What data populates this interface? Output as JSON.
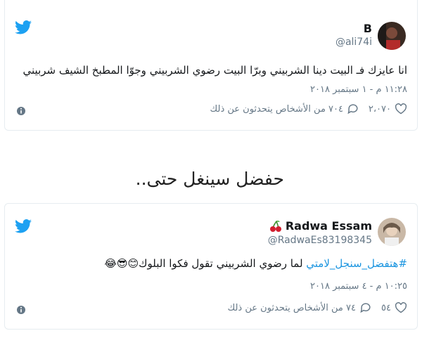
{
  "tweet1": {
    "display_name": "B",
    "handle": "@ali74i",
    "text": "انا عايزك فـ البيت دينا الشربيني وبرّا البيت رضوي الشربيني وجوّا المطبخ الشيف شربيني",
    "timestamp": "١١:٢٨ م - ١ سبتمبر ٢٠١٨",
    "likes": "٢،٠٧٠",
    "replies_text": "٧٠٤ من الأشخاص يتحدثون عن ذلك"
  },
  "heading": "حفضل سينغل حتى..",
  "tweet2": {
    "display_name": "Radwa Essam",
    "handle": "@RadwaEs83198345",
    "hashtag": "#هتفضل_سنجل_لامتي",
    "text_rest": " لما رضوي الشربيني تقول فكوا البلوك",
    "emojis": "😊😎😂",
    "timestamp": "١٠:٢٥ م - ٤ سبتمبر ٢٠١٨",
    "likes": "٥٤",
    "replies_text": "٧٤ من الأشخاص يتحدثون عن ذلك"
  },
  "colors": {
    "twitter_blue": "#1da1f2",
    "muted": "#657786",
    "border": "#e6ecf0",
    "link": "#1b95e0"
  }
}
